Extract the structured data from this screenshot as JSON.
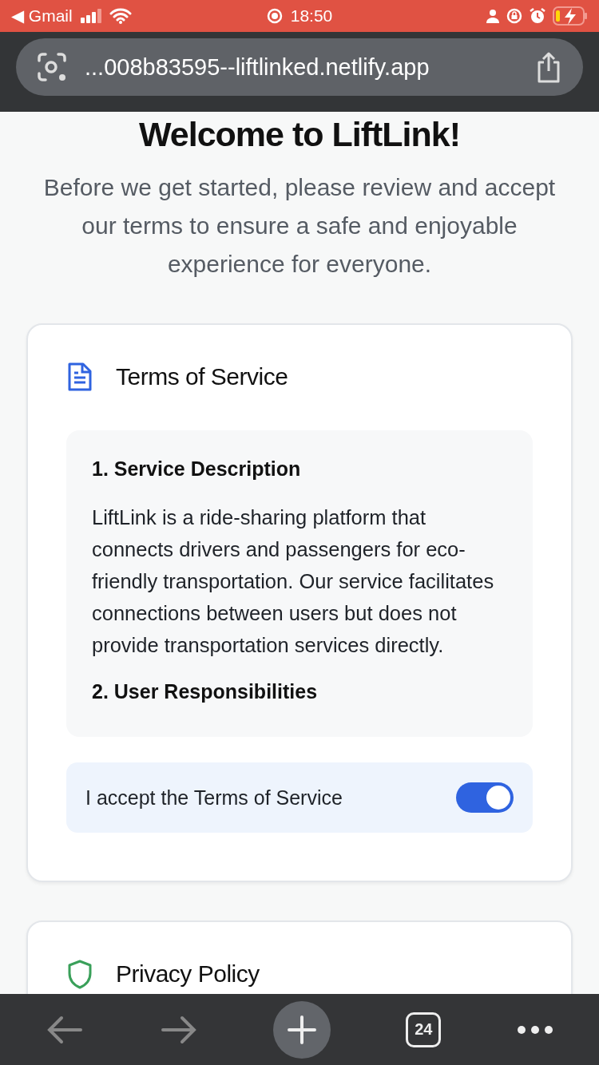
{
  "status_bar": {
    "back_app": "◀ Gmail",
    "time": "18:50"
  },
  "address_bar": {
    "url": "...008b83595--liftlinked.netlify.app"
  },
  "page": {
    "title": "Welcome to LiftLink!",
    "intro": "Before we get started, please review and accept our terms to ensure a safe and enjoyable experience for everyone."
  },
  "sections": [
    {
      "kind": "document",
      "title": "Terms of Service",
      "content": [
        {
          "heading": "1. Service Description",
          "body": "LiftLink is a ride-sharing platform that connects drivers and passengers for eco-friendly transportation. Our service facilitates connections between users but does not provide transportation services directly."
        },
        {
          "heading": "2. User Responsibilities"
        }
      ],
      "accept": {
        "label": "I accept the Terms of Service",
        "on": true
      }
    },
    {
      "kind": "shield",
      "title": "Privacy Policy"
    }
  ],
  "toolbar": {
    "tab_count": "24"
  }
}
